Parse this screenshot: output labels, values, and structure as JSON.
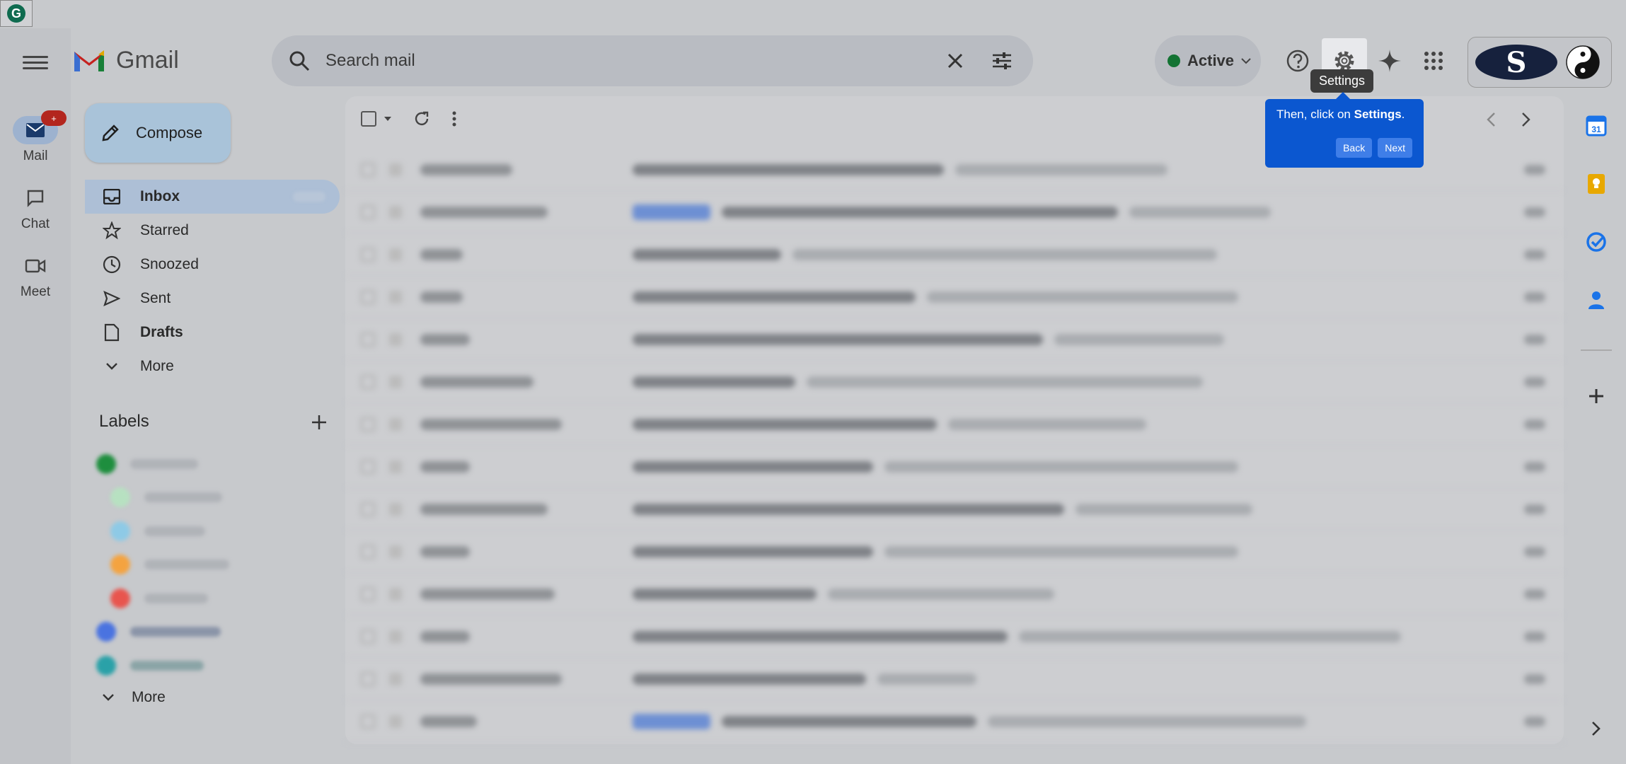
{
  "header": {
    "app_name": "Gmail",
    "search_placeholder": "Search mail",
    "status_label": "Active",
    "settings_tooltip": "Settings",
    "account_logo_letter": "S"
  },
  "rail": {
    "items": [
      {
        "label": "Mail",
        "badge": "+"
      },
      {
        "label": "Chat"
      },
      {
        "label": "Meet"
      }
    ]
  },
  "compose_label": "Compose",
  "nav": {
    "items": [
      {
        "label": "Inbox",
        "icon": "inbox-icon"
      },
      {
        "label": "Starred",
        "icon": "star-icon"
      },
      {
        "label": "Snoozed",
        "icon": "clock-icon"
      },
      {
        "label": "Sent",
        "icon": "send-icon"
      },
      {
        "label": "Drafts",
        "icon": "draft-icon"
      },
      {
        "label": "More",
        "icon": "chevron-down-icon"
      }
    ]
  },
  "labels": {
    "heading": "Labels",
    "more_label": "More",
    "dot_colors": [
      "#1e8e3e",
      "#b7e1c1",
      "#8ecae6",
      "#f4a340",
      "#e8554e",
      "#4a73e0",
      "#2aa1a8"
    ]
  },
  "popover": {
    "text_prefix": "Then, click on ",
    "text_bold": "Settings",
    "text_suffix": ".",
    "back_label": "Back",
    "next_label": "Next"
  },
  "colors": {
    "accent": "#0b57d0",
    "active_status": "#137333"
  }
}
